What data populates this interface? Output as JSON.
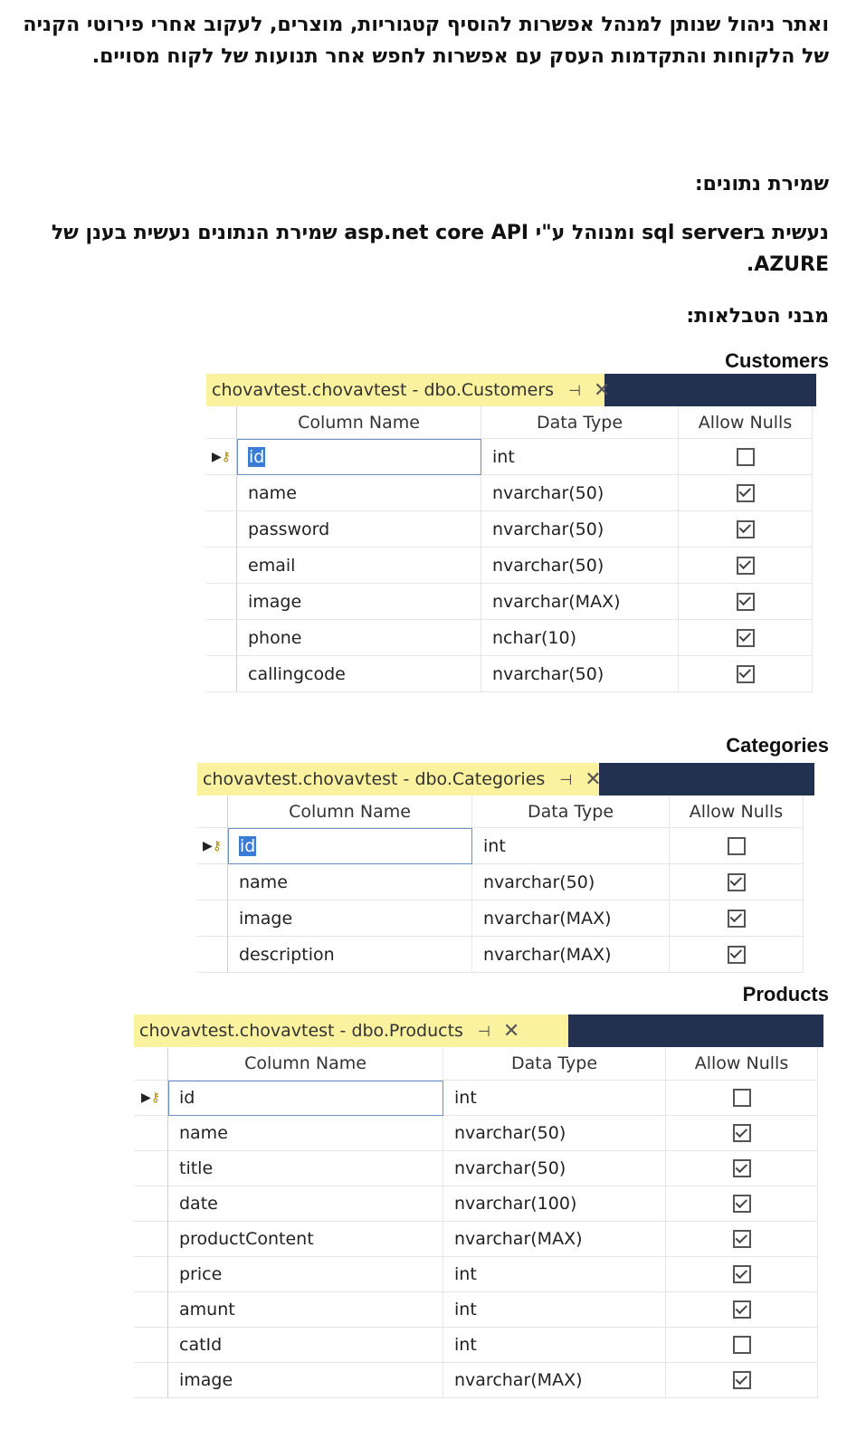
{
  "intro": "ואתר ניהול שנותן למנהל אפשרות להוסיף קטגוריות, מוצרים, לעקוב אחרי פירוטי הקניה של הלקוחות והתקדמות העסק עם אפשרות לחפש אחר תנועות של לקוח מסויים.",
  "storage": {
    "heading": "שמירת נתונים:",
    "text": "נעשית בsql server ומנוהל ע\"י asp.net core API שמירת הנתונים נעשית בענן של AZURE."
  },
  "tables_heading": "מבני הטבלאות:",
  "headers": {
    "name": "Column Name",
    "type": "Data Type",
    "nulls": "Allow Nulls"
  },
  "tab_pin": "⊣",
  "tab_close": "✕",
  "tables": [
    {
      "title": "Customers",
      "tab": "chovavtest.chovavtest - dbo.Customers",
      "rows": [
        {
          "name": "id",
          "type": "int",
          "nulls": false
        },
        {
          "name": "name",
          "type": "nvarchar(50)",
          "nulls": true
        },
        {
          "name": "password",
          "type": "nvarchar(50)",
          "nulls": true
        },
        {
          "name": "email",
          "type": "nvarchar(50)",
          "nulls": true
        },
        {
          "name": "image",
          "type": "nvarchar(MAX)",
          "nulls": true
        },
        {
          "name": "phone",
          "type": "nchar(10)",
          "nulls": true
        },
        {
          "name": "callingcode",
          "type": "nvarchar(50)",
          "nulls": true
        }
      ]
    },
    {
      "title": "Categories",
      "tab": "chovavtest.chovavtest - dbo.Categories",
      "rows": [
        {
          "name": "id",
          "type": "int",
          "nulls": false
        },
        {
          "name": "name",
          "type": "nvarchar(50)",
          "nulls": true
        },
        {
          "name": "image",
          "type": "nvarchar(MAX)",
          "nulls": true
        },
        {
          "name": "description",
          "type": "nvarchar(MAX)",
          "nulls": true
        }
      ]
    },
    {
      "title": "Products",
      "tab": "chovavtest.chovavtest - dbo.Products",
      "rows": [
        {
          "name": "id",
          "type": "int",
          "nulls": false
        },
        {
          "name": "name",
          "type": "nvarchar(50)",
          "nulls": true
        },
        {
          "name": "title",
          "type": "nvarchar(50)",
          "nulls": true
        },
        {
          "name": "date",
          "type": "nvarchar(100)",
          "nulls": true
        },
        {
          "name": "productContent",
          "type": "nvarchar(MAX)",
          "nulls": true
        },
        {
          "name": "price",
          "type": "int",
          "nulls": true
        },
        {
          "name": "amunt",
          "type": "int",
          "nulls": true
        },
        {
          "name": "catId",
          "type": "int",
          "nulls": false
        },
        {
          "name": "image",
          "type": "nvarchar(MAX)",
          "nulls": true
        }
      ]
    }
  ]
}
